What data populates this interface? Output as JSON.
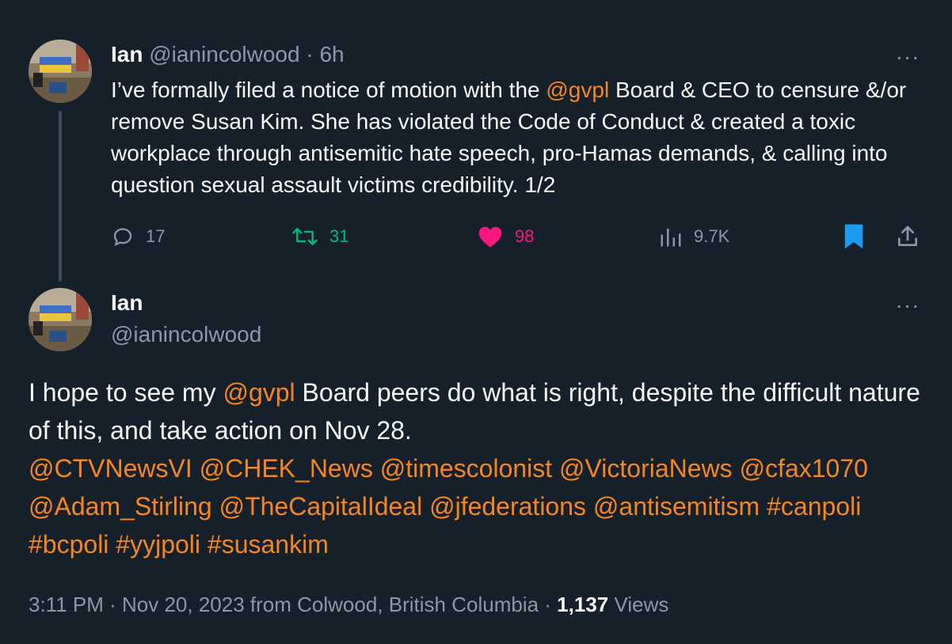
{
  "colors": {
    "background": "#15202b",
    "text": "#f7f9f9",
    "muted": "#8b98a5",
    "link": "#f6861f",
    "retweet": "#00ba7c",
    "like": "#f91880",
    "bookmark": "#1d9bf0"
  },
  "tweet1": {
    "name": "Ian",
    "handle": "@ianincolwood",
    "separator": "·",
    "time": "6h",
    "more": "···",
    "text_before": "I’ve formally filed a notice of motion with the ",
    "mention": "@gvpl",
    "text_after": " Board & CEO to censure &/or remove Susan Kim. She has violated the Code of Conduct & created a toxic workplace through antisemitic hate speech, pro-Hamas demands, & calling into question sexual assault victims credibility. 1/2",
    "actions": {
      "replies": "17",
      "retweets": "31",
      "likes": "98",
      "views": "9.7K"
    },
    "icons": [
      "reply-icon",
      "retweet-icon",
      "like-icon",
      "analytics-icon",
      "bookmark-icon",
      "share-icon"
    ]
  },
  "tweet2": {
    "name": "Ian",
    "handle": "@ianincolwood",
    "more": "···",
    "text_before": "I hope to see my ",
    "mention": "@gvpl",
    "text_after": " Board peers do what is right, despite the difficult nature of this, and take action on Nov 28.",
    "tags": [
      "@CTVNewsVI",
      "@CHEK_News",
      "@timescolonist",
      "@VictoriaNews",
      "@cfax1070",
      "@Adam_Stirling",
      "@TheCapitalIdeal",
      "@jfederations",
      "@antisemitism",
      "#canpoli",
      "#bcpoli",
      "#yyjpoli",
      "#susankim"
    ],
    "meta": {
      "time": "3:11 PM",
      "date": "Nov 20, 2023",
      "location": "from Colwood, British Columbia",
      "views_count": "1,137",
      "views_label": "Views"
    }
  }
}
